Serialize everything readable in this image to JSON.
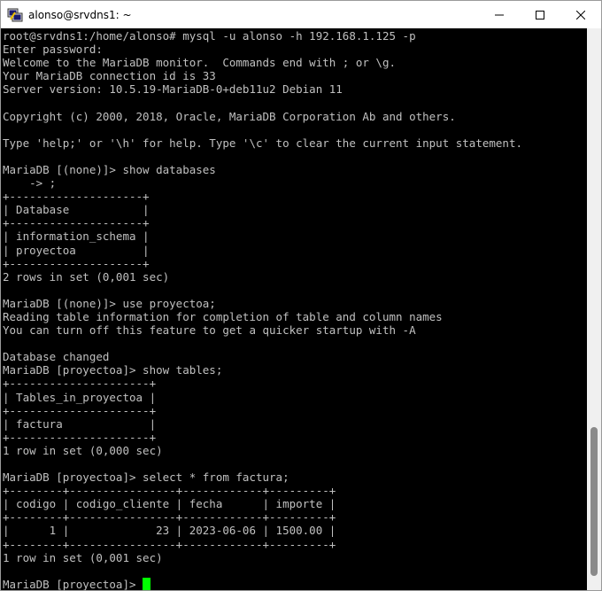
{
  "window": {
    "title": "alonso@srvdns1: ~"
  },
  "terminal": {
    "lines": [
      "root@srvdns1:/home/alonso# mysql -u alonso -h 192.168.1.125 -p",
      "Enter password:",
      "Welcome to the MariaDB monitor.  Commands end with ; or \\g.",
      "Your MariaDB connection id is 33",
      "Server version: 10.5.19-MariaDB-0+deb11u2 Debian 11",
      "",
      "Copyright (c) 2000, 2018, Oracle, MariaDB Corporation Ab and others.",
      "",
      "Type 'help;' or '\\h' for help. Type '\\c' to clear the current input statement.",
      "",
      "MariaDB [(none)]> show databases",
      "    -> ;",
      "+--------------------+",
      "| Database           |",
      "+--------------------+",
      "| information_schema |",
      "| proyectoa          |",
      "+--------------------+",
      "2 rows in set (0,001 sec)",
      "",
      "MariaDB [(none)]> use proyectoa;",
      "Reading table information for completion of table and column names",
      "You can turn off this feature to get a quicker startup with -A",
      "",
      "Database changed",
      "MariaDB [proyectoa]> show tables;",
      "+---------------------+",
      "| Tables_in_proyectoa |",
      "+---------------------+",
      "| factura             |",
      "+---------------------+",
      "1 row in set (0,000 sec)",
      "",
      "MariaDB [proyectoa]> select * from factura;",
      "+--------+----------------+------------+---------+",
      "| codigo | codigo_cliente | fecha      | importe |",
      "+--------+----------------+------------+---------+",
      "|      1 |             23 | 2023-06-06 | 1500.00 |",
      "+--------+----------------+------------+---------+",
      "1 row in set (0,001 sec)",
      ""
    ],
    "prompt": "MariaDB [proyectoa]> "
  },
  "colors": {
    "background": "#000000",
    "text": "#c0c0c0",
    "cursor": "#00ff00"
  },
  "icons": {
    "app": "putty-icon",
    "minimize": "minimize-icon",
    "maximize": "maximize-icon",
    "close": "close-icon"
  }
}
